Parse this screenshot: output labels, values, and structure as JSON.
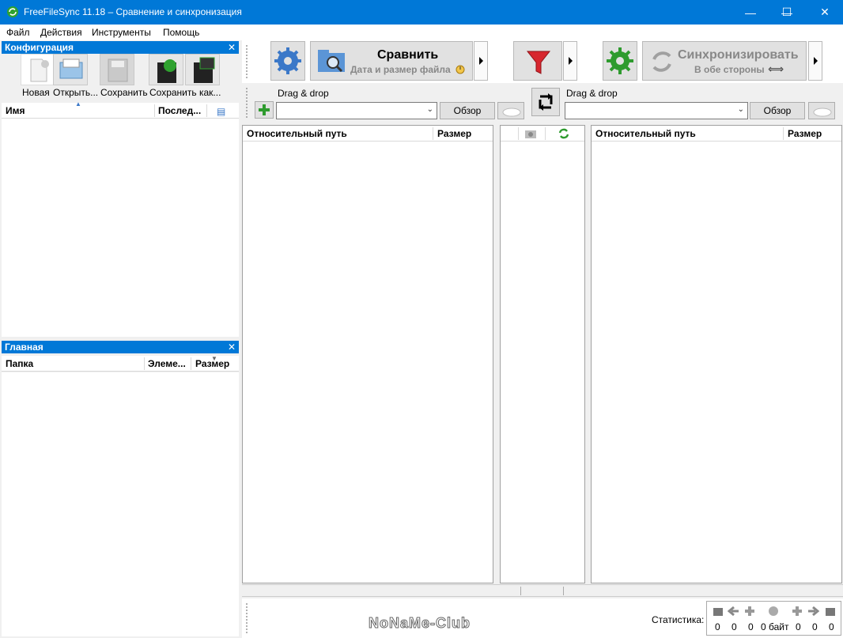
{
  "window": {
    "title": "FreeFileSync 11.18 – Сравнение и синхронизация",
    "minimize": "—",
    "maximize": "☐",
    "close": "✕"
  },
  "menu": [
    "Файл",
    "Действия",
    "Инструменты",
    "Помощь"
  ],
  "config_panel": {
    "title": "Конфигурация",
    "close": "✕",
    "buttons": [
      {
        "label": "Новая",
        "icon": "new-file-icon"
      },
      {
        "label": "Открыть...",
        "icon": "open-icon"
      },
      {
        "label": "Сохранить",
        "icon": "save-icon"
      },
      {
        "label": "Сохранить как...",
        "icon": "save-as-icon"
      },
      {
        "label": "",
        "icon": "save-batch-icon"
      }
    ],
    "columns": {
      "name": "Имя",
      "last": "Послед..."
    }
  },
  "main_panel": {
    "title": "Главная",
    "close": "✕",
    "columns": {
      "folder": "Папка",
      "items": "Элеме...",
      "size": "Размер"
    }
  },
  "toolbar": {
    "compare_title": "Сравнить",
    "compare_subtitle": "Дата и размер файла",
    "sync_title": "Синхронизировать",
    "sync_subtitle": "В обе стороны",
    "sync_arrows": "⟺"
  },
  "left_folder": {
    "drag_label": "Drag & drop",
    "browse": "Обзор",
    "value": ""
  },
  "right_folder": {
    "drag_label": "Drag & drop",
    "browse": "Обзор",
    "value": ""
  },
  "grid": {
    "left_cols": {
      "path": "Относительный путь",
      "size": "Размер"
    },
    "right_cols": {
      "path": "Относительный путь",
      "size": "Размер"
    }
  },
  "status": {
    "stats_label": "Статистика:",
    "counts": [
      "0",
      "0",
      "0",
      "0 байт",
      "0",
      "0",
      "0"
    ]
  },
  "watermark": "NoNaMe-Club",
  "colors": {
    "accent": "#0078d7",
    "filter_red": "#d7262e",
    "gear_green": "#2e9b2e",
    "gear_blue": "#3b78c8"
  }
}
